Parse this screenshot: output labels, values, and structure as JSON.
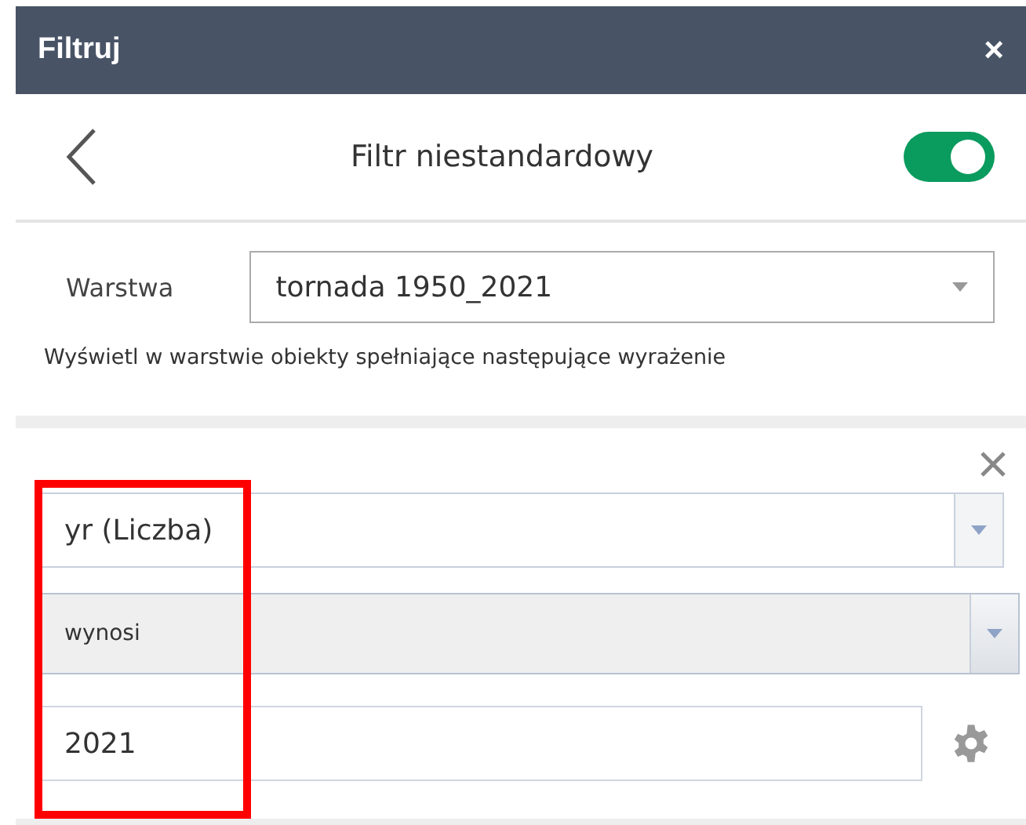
{
  "window": {
    "title": "Filtruj",
    "close": "×"
  },
  "header": {
    "title": "Filtr niestandardowy",
    "toggle": {
      "on": true
    }
  },
  "layer": {
    "label": "Warstwa",
    "value": "tornada 1950_2021"
  },
  "description": "Wyświetl w warstwie obiekty spełniające następujące wyrażenie",
  "expression": {
    "field": "yr (Liczba)",
    "operator": "wynosi",
    "value": "2021"
  },
  "annotation": {
    "kind": "highlight"
  }
}
